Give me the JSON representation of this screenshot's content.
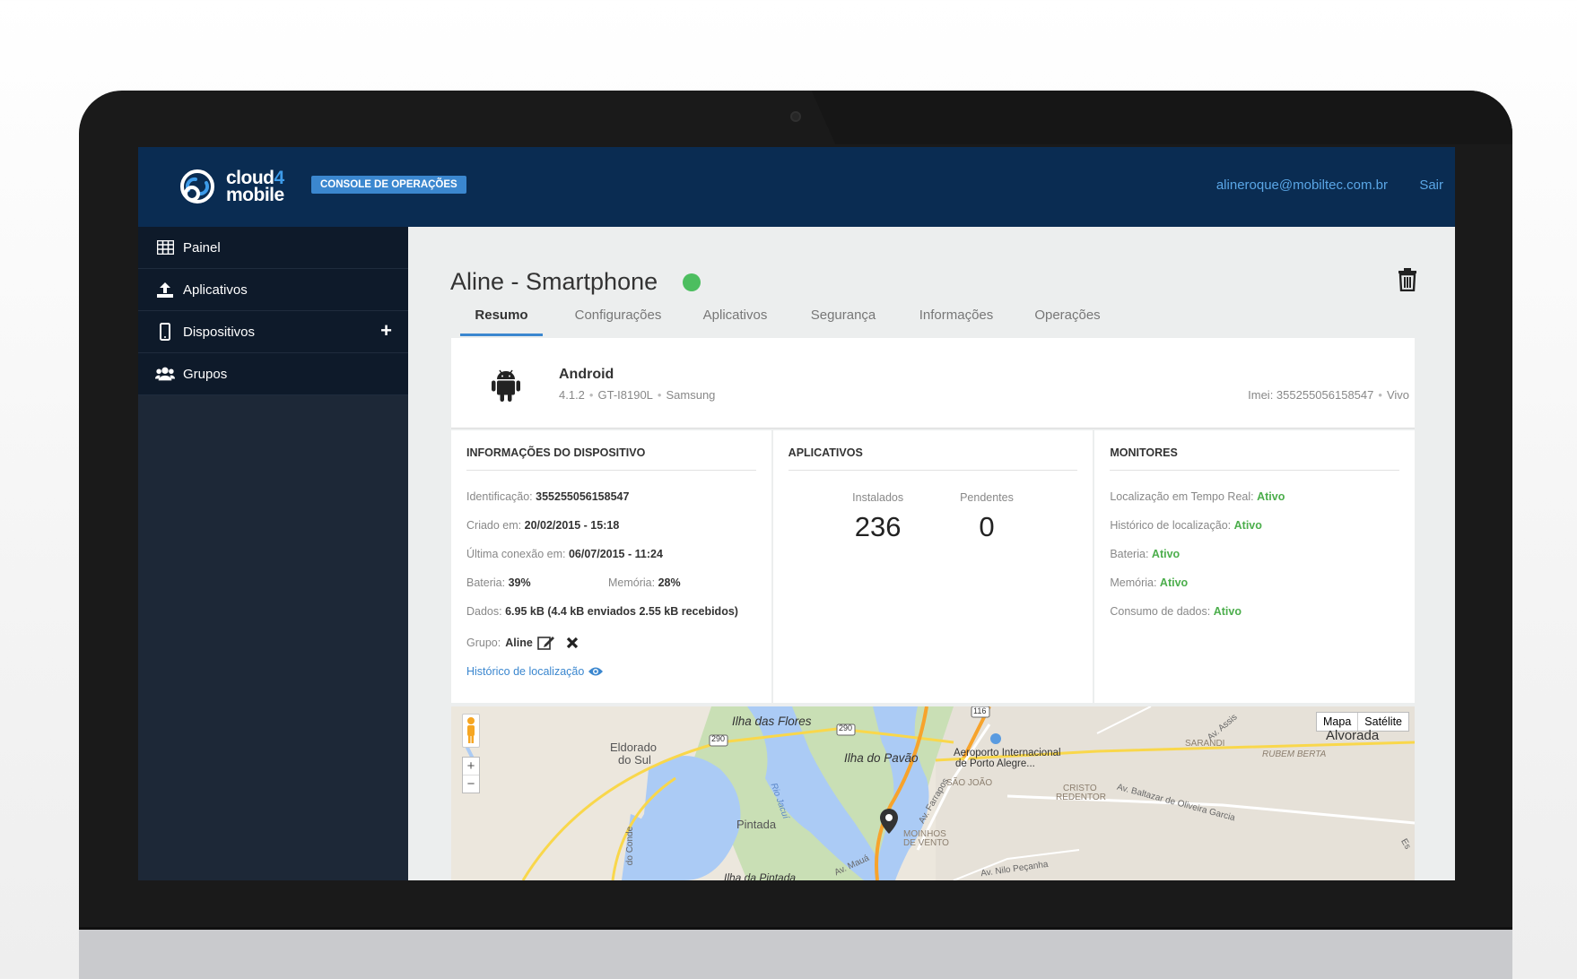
{
  "app": {
    "brand_line1": "cloud",
    "brand_four": "4",
    "brand_line2": "mobile",
    "console_badge": "CONSOLE DE OPERAÇÕES",
    "user_email": "alineroque@mobiltec.com.br",
    "logout_label": "Sair"
  },
  "sidebar": {
    "items": [
      {
        "label": "Painel",
        "icon": "table-icon"
      },
      {
        "label": "Aplicativos",
        "icon": "upload-icon"
      },
      {
        "label": "Dispositivos",
        "icon": "phone-icon",
        "has_add": true
      },
      {
        "label": "Grupos",
        "icon": "users-icon"
      }
    ],
    "add_label": "+"
  },
  "device": {
    "title": "Aline - Smartphone",
    "status_color": "#4cbe5f"
  },
  "tabs": [
    {
      "label": "Resumo",
      "active": true
    },
    {
      "label": "Configurações"
    },
    {
      "label": "Aplicativos"
    },
    {
      "label": "Segurança"
    },
    {
      "label": "Informações"
    },
    {
      "label": "Operações"
    }
  ],
  "summary": {
    "os": "Android",
    "version": "4.1.2",
    "model": "GT-I8190L",
    "manufacturer": "Samsung",
    "imei": "Imei: 355255056158547",
    "carrier": "Vivo",
    "sep": "•"
  },
  "panel_info": {
    "title": "INFORMAÇÕES DO DISPOSITIVO",
    "id_label": "Identificação:",
    "id_value": "355255056158547",
    "created_label": "Criado em:",
    "created_value": "20/02/2015 - 15:18",
    "last_conn_label": "Última conexão em:",
    "last_conn_value": "06/07/2015 - 11:24",
    "battery_label": "Bateria:",
    "battery_value": "39%",
    "memory_label": "Memória:",
    "memory_value": "28%",
    "data_label": "Dados:",
    "data_value": "6.95 kB (4.4 kB enviados 2.55 kB recebidos)",
    "group_label": "Grupo:",
    "group_value": "Aline",
    "history_link": "Histórico de localização"
  },
  "panel_apps": {
    "title": "APLICATIVOS",
    "installed_label": "Instalados",
    "installed_value": "236",
    "pending_label": "Pendentes",
    "pending_value": "0"
  },
  "panel_monitors": {
    "title": "MONITORES",
    "items": [
      {
        "label": "Localização em Tempo Real:",
        "value": "Ativo"
      },
      {
        "label": "Histórico de localização:",
        "value": "Ativo"
      },
      {
        "label": "Bateria:",
        "value": "Ativo"
      },
      {
        "label": "Memória:",
        "value": "Ativo"
      },
      {
        "label": "Consumo de dados:",
        "value": "Ativo"
      }
    ]
  },
  "map": {
    "type_map": "Mapa",
    "type_satellite": "Satélite",
    "zoom_in": "+",
    "zoom_out": "−",
    "labels": {
      "ilha_flores": "Ilha das Flores",
      "eldorado": "Eldorado",
      "do_sul": "do Sul",
      "ilha_pavao": "Ilha do Pavão",
      "aeroporto1": "Aeroporto Internacional",
      "aeroporto2": "de Porto Alegre...",
      "alvorada": "Alvorada",
      "sarandi": "SARANDI",
      "rubem_berta": "RUBEM BERTA",
      "sao_joao": "SÃO JOÃO",
      "cristo1": "CRISTO",
      "cristo2": "REDENTOR",
      "pintada": "Pintada",
      "moinhos1": "MOINHOS",
      "moinhos2": "DE VENTO",
      "ilha_pintada": "Ilha da Pintada",
      "rio_jacui": "Rio Jacuí",
      "av_baltazar": "Av. Baltazar de Oliveira Garcia",
      "av_farrapos": "Av. Farrapos",
      "av_maua": "Av. Mauá",
      "av_assis": "Av. Assis",
      "av_nilo": "Av. Nilo Peçanha",
      "r290a": "290",
      "r290b": "290",
      "r116": "116",
      "conde": "do Conde",
      "es": "Es"
    }
  }
}
